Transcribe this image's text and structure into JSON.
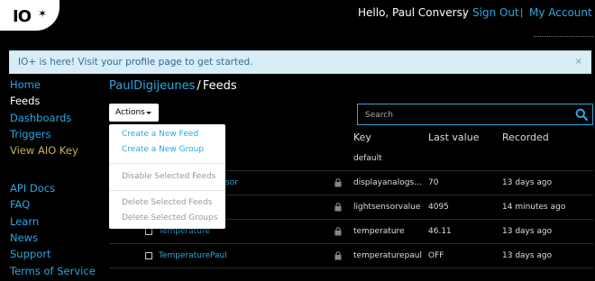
{
  "header": {
    "logo_text": "IO",
    "greeting": "Hello, Paul Conversy",
    "separator": "|",
    "sign_out": "Sign Out",
    "my_account": "My Account"
  },
  "alert": {
    "text_before": "IO+ is here! Visit your ",
    "link_text": "profile page",
    "text_after": " to get started.",
    "close": "×"
  },
  "sidebar": {
    "items": [
      {
        "label": "Home"
      },
      {
        "label": "Feeds"
      },
      {
        "label": "Dashboards"
      },
      {
        "label": "Triggers"
      },
      {
        "label": "View AIO Key"
      },
      {
        "label": "API Docs"
      },
      {
        "label": "FAQ"
      },
      {
        "label": "Learn"
      },
      {
        "label": "News"
      },
      {
        "label": "Support"
      },
      {
        "label": "Terms of Service"
      }
    ]
  },
  "breadcrumb": {
    "user": "PaulDigijeunes",
    "separator": "/",
    "current": "Feeds"
  },
  "toolbar": {
    "actions_label": "Actions",
    "search_placeholder": "Search"
  },
  "actions_menu": {
    "create_feed": "Create a New Feed",
    "create_group": "Create a New Group",
    "disable_feeds": "Disable Selected Feeds",
    "delete_feeds": "Delete Selected Feeds",
    "delete_groups": "Delete Selected Groups"
  },
  "table": {
    "headers": {
      "key": "Key",
      "last_value": "Last value",
      "recorded": "Recorded"
    },
    "rows": [
      {
        "name": "",
        "key": "default",
        "last_value": "",
        "recorded": ""
      },
      {
        "name": "sor",
        "key": "displayanalogs...",
        "last_value": "70",
        "recorded": "13 days ago"
      },
      {
        "name": "",
        "key": "lightsensorvalue",
        "last_value": "4095",
        "recorded": "14 minutes ago"
      },
      {
        "name": "Temperature",
        "key": "temperature",
        "last_value": "46.11",
        "recorded": "13 days ago"
      },
      {
        "name": "TemperaturePaul",
        "key": "temperaturepaul",
        "last_value": "OFF",
        "recorded": "13 days ago"
      }
    ]
  },
  "colors": {
    "accent": "#2ca7df",
    "background": "#000000",
    "alert_bg": "#d9edf7",
    "alert_text": "#31708f",
    "sidebar_yellow": "#c8b25a"
  }
}
